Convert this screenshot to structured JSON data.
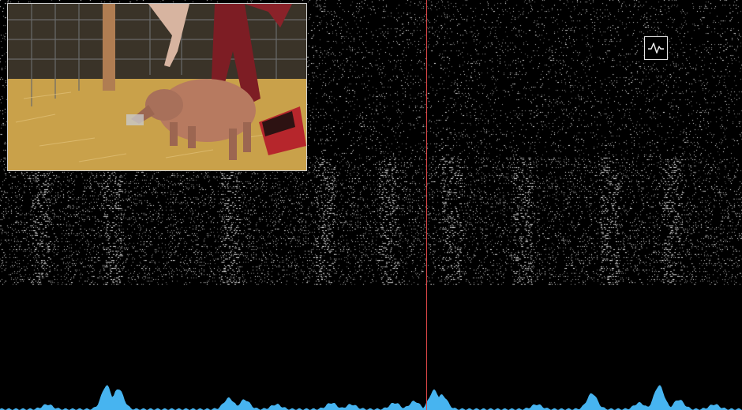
{
  "video": {
    "description_icon": "camera-feed"
  },
  "controls": {
    "waveform_toggle_icon": "waveform-icon"
  },
  "colors": {
    "background": "#000000",
    "spike_dots": "#ffffff",
    "activity_trace": "#47b4f0",
    "playhead": "#e04848",
    "inset_border": "#cfcfcf"
  },
  "raster": {
    "channel_count": 1024,
    "time_window_fraction_playhead": 0.574
  }
}
